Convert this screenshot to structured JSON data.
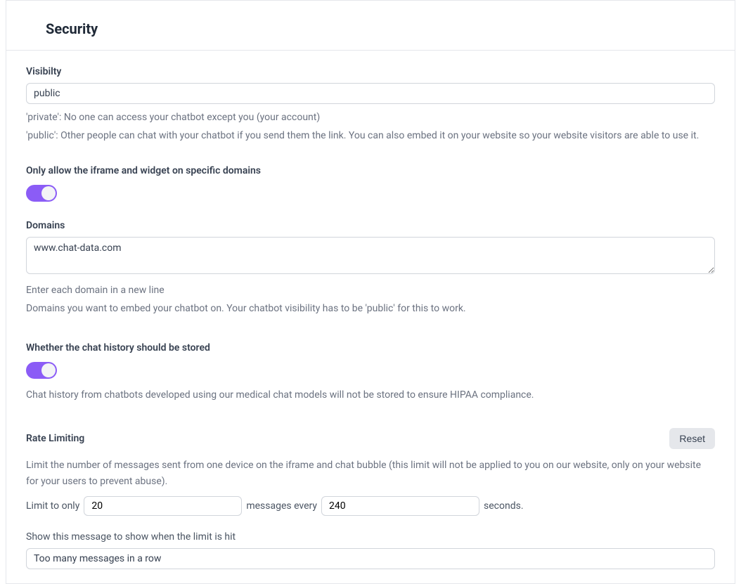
{
  "header": {
    "title": "Security"
  },
  "visibility": {
    "label": "Visibilty",
    "value": "public",
    "help_private": "'private': No one can access your chatbot except you (your account)",
    "help_public": "'public': Other people can chat with your chatbot if you send them the link. You can also embed it on your website so your website visitors are able to use it."
  },
  "iframe": {
    "label": "Only allow the iframe and widget on specific domains",
    "enabled": true
  },
  "domains": {
    "label": "Domains",
    "value": "www.chat-data.com",
    "help1": "Enter each domain in a new line",
    "help2": "Domains you want to embed your chatbot on. Your chatbot visibility has to be 'public' for this to work."
  },
  "history": {
    "label": "Whether the chat history should be stored",
    "enabled": true,
    "help": "Chat history from chatbots developed using our medical chat models will not be stored to ensure HIPAA compliance."
  },
  "rate": {
    "label": "Rate Limiting",
    "reset": "Reset",
    "desc": "Limit the number of messages sent from one device on the iframe and chat bubble (this limit will not be applied to you on our website, only on your website for your users to prevent abuse).",
    "limit_prefix": "Limit to only",
    "limit_count": "20",
    "limit_mid": "messages every",
    "limit_seconds": "240",
    "limit_suffix": "seconds.",
    "msg_label": "Show this message to show when the limit is hit",
    "msg_value": "Too many messages in a row"
  }
}
